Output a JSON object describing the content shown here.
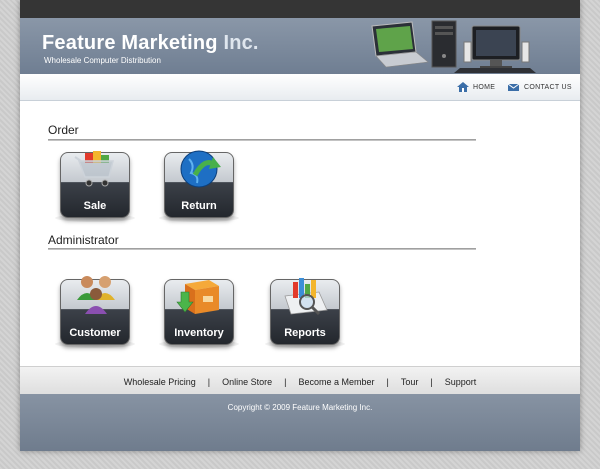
{
  "header": {
    "brand_main": "Feature Marketing",
    "brand_accent": "Inc.",
    "tagline": "Wholesale Computer Distribution"
  },
  "nav": {
    "home": "HOME",
    "contact": "CONTACT US"
  },
  "sections": [
    {
      "title": "Order",
      "tiles": [
        {
          "label": "Sale",
          "icon": "shopping-cart-icon"
        },
        {
          "label": "Return",
          "icon": "globe-return-icon"
        }
      ]
    },
    {
      "title": "Administrator",
      "tiles": [
        {
          "label": "Customer",
          "icon": "people-icon"
        },
        {
          "label": "Inventory",
          "icon": "box-icon"
        },
        {
          "label": "Reports",
          "icon": "chart-magnifier-icon"
        }
      ]
    }
  ],
  "footer_nav": [
    "Wholesale Pricing",
    "Online Store",
    "Become a Member",
    "Tour",
    "Support"
  ],
  "copyright": "Copyright © 2009 Feature Marketing Inc.",
  "colors": {
    "topbar": "#353535",
    "header": "#7d8a9c",
    "footer": "#7a8798",
    "page_bg": "#cfcfcf"
  }
}
